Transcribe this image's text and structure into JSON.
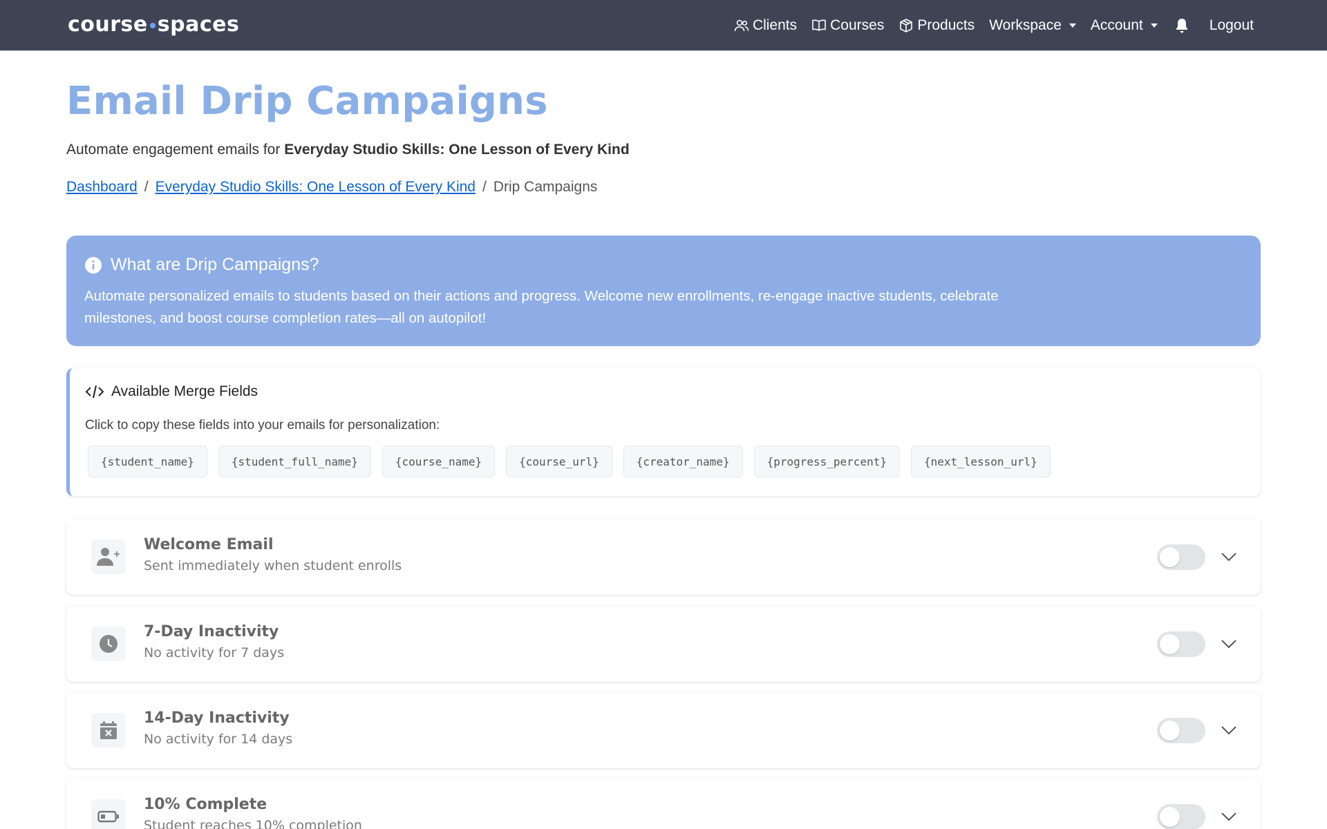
{
  "navbar": {
    "brand_left": "course",
    "brand_right": "spaces",
    "items": [
      {
        "label": "Clients",
        "icon": "users-icon"
      },
      {
        "label": "Courses",
        "icon": "book-icon"
      },
      {
        "label": "Products",
        "icon": "box-icon"
      },
      {
        "label": "Workspace",
        "icon": "dropdown"
      },
      {
        "label": "Account",
        "icon": "dropdown"
      },
      {
        "label": "Logout"
      }
    ],
    "bell_icon": "bell-icon"
  },
  "page": {
    "title": "Email Drip Campaigns",
    "subtitle_prefix": "Automate engagement emails for ",
    "subtitle_course": "Everyday Studio Skills: One Lesson of Every Kind"
  },
  "breadcrumb": {
    "items": [
      "Dashboard",
      "Everyday Studio Skills: One Lesson of Every Kind",
      "Drip Campaigns"
    ],
    "separator": "/"
  },
  "info": {
    "title": "What are Drip Campaigns?",
    "text": "Automate personalized emails to students based on their actions and progress. Welcome new enrollments, re-engage inactive students, celebrate milestones, and boost course completion rates—all on autopilot!"
  },
  "merge_fields": {
    "title": "Available Merge Fields",
    "description": "Click to copy these fields into your emails for personalization:",
    "fields": [
      "{student_name}",
      "{student_full_name}",
      "{course_name}",
      "{course_url}",
      "{creator_name}",
      "{progress_percent}",
      "{next_lesson_url}"
    ]
  },
  "campaigns": [
    {
      "title": "Welcome Email",
      "subtitle": "Sent immediately when student enrolls",
      "icon": "user-plus-icon",
      "enabled": false
    },
    {
      "title": "7-Day Inactivity",
      "subtitle": "No activity for 7 days",
      "icon": "clock-icon",
      "enabled": false
    },
    {
      "title": "14-Day Inactivity",
      "subtitle": "No activity for 14 days",
      "icon": "calendar-x-icon",
      "enabled": false
    },
    {
      "title": "10% Complete",
      "subtitle": "Student reaches 10% completion",
      "icon": "battery-low-icon",
      "enabled": false
    }
  ],
  "colors": {
    "navbar": "#3f4455",
    "title": "#8aaee6",
    "banner": "#8eade6",
    "link": "#0a63d6"
  }
}
